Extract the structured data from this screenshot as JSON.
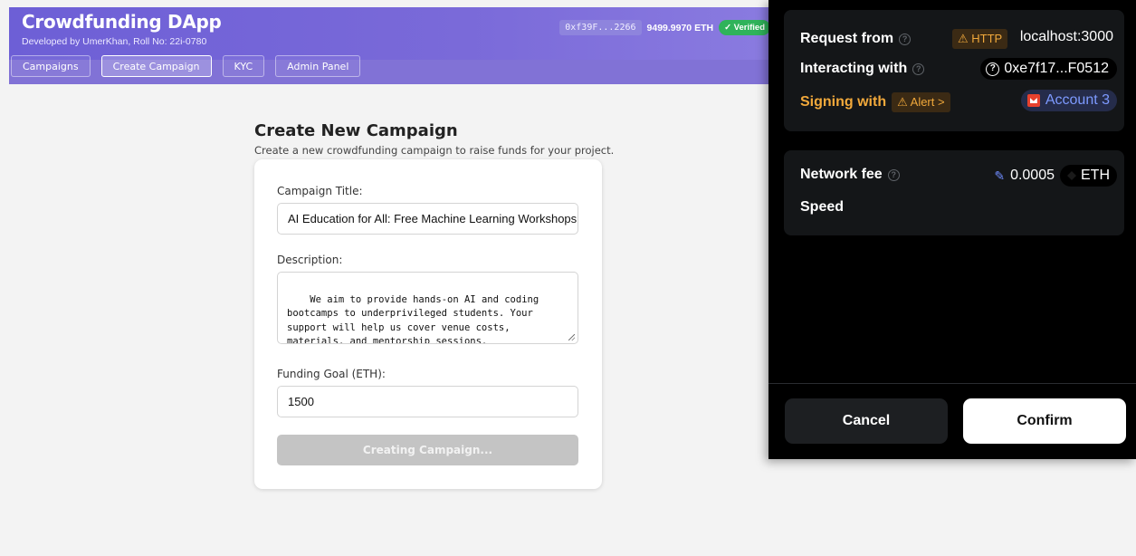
{
  "app": {
    "title": "Crowdfunding DApp",
    "subtitle": "Developed by UmerKhan, Roll No: 22i-0780",
    "wallet_address": "0xf39F...2266",
    "balance": "9499.9970 ETH",
    "verified_label": "✓ Verified"
  },
  "nav": {
    "campaigns": "Campaigns",
    "create_campaign": "Create Campaign",
    "kyc": "KYC",
    "admin_panel": "Admin Panel"
  },
  "page": {
    "title": "Create New Campaign",
    "subtitle": "Create a new crowdfunding campaign to raise funds for your project."
  },
  "form": {
    "title_label": "Campaign Title:",
    "title_value": "AI Education for All: Free Machine Learning Workshops",
    "description_label": "Description:",
    "description_value": "We aim to provide hands-on AI and coding\nbootcamps to underprivileged students. Your\nsupport will help us cover venue costs,\nmaterials, and mentorship sessions.",
    "goal_label": "Funding Goal (ETH):",
    "goal_value": "1500",
    "submit_label": "Creating Campaign..."
  },
  "wallet_popup": {
    "request_from_label": "Request from",
    "http_badge": "⚠ HTTP",
    "host": "localhost:3000",
    "interacting_label": "Interacting with",
    "contract_address": "0xe7f17...F0512",
    "signing_label": "Signing with",
    "alert_badge": "⚠ Alert >",
    "account_name": "Account 3",
    "network_fee_label": "Network fee",
    "fee_amount": "0.0005",
    "fee_currency": "ETH",
    "speed_label": "Speed",
    "cancel_label": "Cancel",
    "confirm_label": "Confirm",
    "accent_color": "#f2a93b"
  }
}
